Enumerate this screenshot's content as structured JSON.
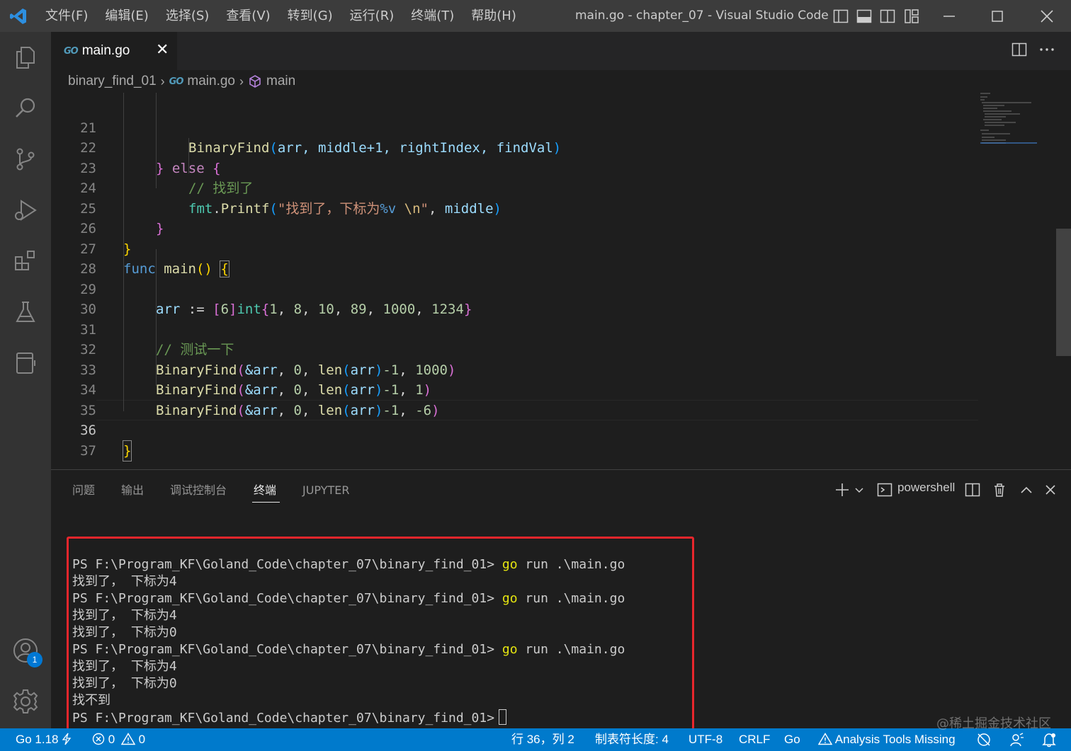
{
  "window": {
    "title": "main.go - chapter_07 - Visual Studio Code",
    "menu": [
      "文件(F)",
      "编辑(E)",
      "选择(S)",
      "查看(V)",
      "转到(G)",
      "运行(R)",
      "终端(T)",
      "帮助(H)"
    ]
  },
  "activity_bar": {
    "items": [
      "files-icon",
      "search-icon",
      "source-control-icon",
      "run-debug-icon",
      "extensions-icon",
      "testing-icon",
      "remote-icon"
    ],
    "account_badge": "1"
  },
  "tab": {
    "label": "main.go",
    "lang_glyph": "GO",
    "close": "✕"
  },
  "breadcrumb": {
    "folder": "binary_find_01",
    "file": "main.go",
    "symbol": "main",
    "separator": "›"
  },
  "editor": {
    "active_line": "36",
    "lines": [
      {
        "num": "21"
      },
      {
        "num": "22"
      },
      {
        "num": "23"
      },
      {
        "num": "24"
      },
      {
        "num": "25"
      },
      {
        "num": "26"
      },
      {
        "num": "27"
      },
      {
        "num": "28"
      },
      {
        "num": "29"
      },
      {
        "num": "30"
      },
      {
        "num": "31"
      },
      {
        "num": "32"
      },
      {
        "num": "33"
      },
      {
        "num": "34"
      },
      {
        "num": "35"
      },
      {
        "num": "36"
      },
      {
        "num": "37"
      }
    ],
    "code": {
      "l21": {
        "fn": "BinaryFind",
        "args": "arr, middle+1, rightIndex, findVal"
      },
      "l22": {
        "brace_close": "}",
        "kw": "else",
        "brace_open": "{"
      },
      "l23": {
        "comment": "// 找到了"
      },
      "l24": {
        "pkg": "fmt",
        "fn": "Printf",
        "str_a": "\"找到了，下标为",
        "fmt_verb": "%v",
        "esc": " \\n",
        "str_b": "\"",
        "arg": "middle"
      },
      "l25": {
        "brace": "}"
      },
      "l26": {
        "brace": "}"
      },
      "l27": {
        "kw": "func",
        "fn": "main",
        "parens": "()",
        "brace": "{"
      },
      "l29": {
        "var": "arr",
        "op": ":=",
        "len": "6",
        "type": "int",
        "values": [
          "1",
          "8",
          "10",
          "89",
          "1000",
          "1234"
        ]
      },
      "l31": {
        "comment": "// 测试一下"
      },
      "l32": {
        "fn": "BinaryFind",
        "ref": "&arr",
        "zero": "0",
        "len_fn": "len",
        "arr": "arr",
        "minus": "-1",
        "target": "1000"
      },
      "l33": {
        "fn": "BinaryFind",
        "ref": "&arr",
        "zero": "0",
        "len_fn": "len",
        "arr": "arr",
        "minus": "-1",
        "target": "1"
      },
      "l34": {
        "fn": "BinaryFind",
        "ref": "&arr",
        "zero": "0",
        "len_fn": "len",
        "arr": "arr",
        "minus": "-1",
        "target": "-6"
      },
      "l36": {
        "brace": "}"
      }
    }
  },
  "panel": {
    "tabs": [
      "问题",
      "输出",
      "调试控制台",
      "终端",
      "JUPYTER"
    ],
    "active_tab": "终端",
    "terminal_kind": "powershell",
    "terminal_lines": [
      {
        "prompt": "PS F:\\Program_KF\\Goland_Code\\chapter_07\\binary_find_01>",
        "cmd_go": "go",
        "cmd_rest": " run .\\main.go"
      },
      {
        "text": "找到了， 下标为4"
      },
      {
        "prompt": "PS F:\\Program_KF\\Goland_Code\\chapter_07\\binary_find_01>",
        "cmd_go": "go",
        "cmd_rest": " run .\\main.go"
      },
      {
        "text": "找到了， 下标为4"
      },
      {
        "text": "找到了， 下标为0"
      },
      {
        "prompt": "PS F:\\Program_KF\\Goland_Code\\chapter_07\\binary_find_01>",
        "cmd_go": "go",
        "cmd_rest": " run .\\main.go"
      },
      {
        "text": "找到了， 下标为4"
      },
      {
        "text": "找到了， 下标为0"
      },
      {
        "text": "找不到"
      },
      {
        "prompt": "PS F:\\Program_KF\\Goland_Code\\chapter_07\\binary_find_01>",
        "cmd_go": "",
        "cmd_rest": ""
      }
    ]
  },
  "status_bar": {
    "go_version": "Go 1.18",
    "errors": "0",
    "warnings": "0",
    "cursor_pos": "行 36，列 2",
    "tab_size": "制表符长度: 4",
    "encoding": "UTF-8",
    "eol": "CRLF",
    "language": "Go",
    "analysis": "Analysis Tools Missing"
  },
  "watermark": "@稀土掘金技术社区",
  "colors": {
    "accent": "#007acc",
    "highlight_box": "#e8262c",
    "activity_bar": "#333333",
    "title_bar": "#3c3c3c"
  }
}
